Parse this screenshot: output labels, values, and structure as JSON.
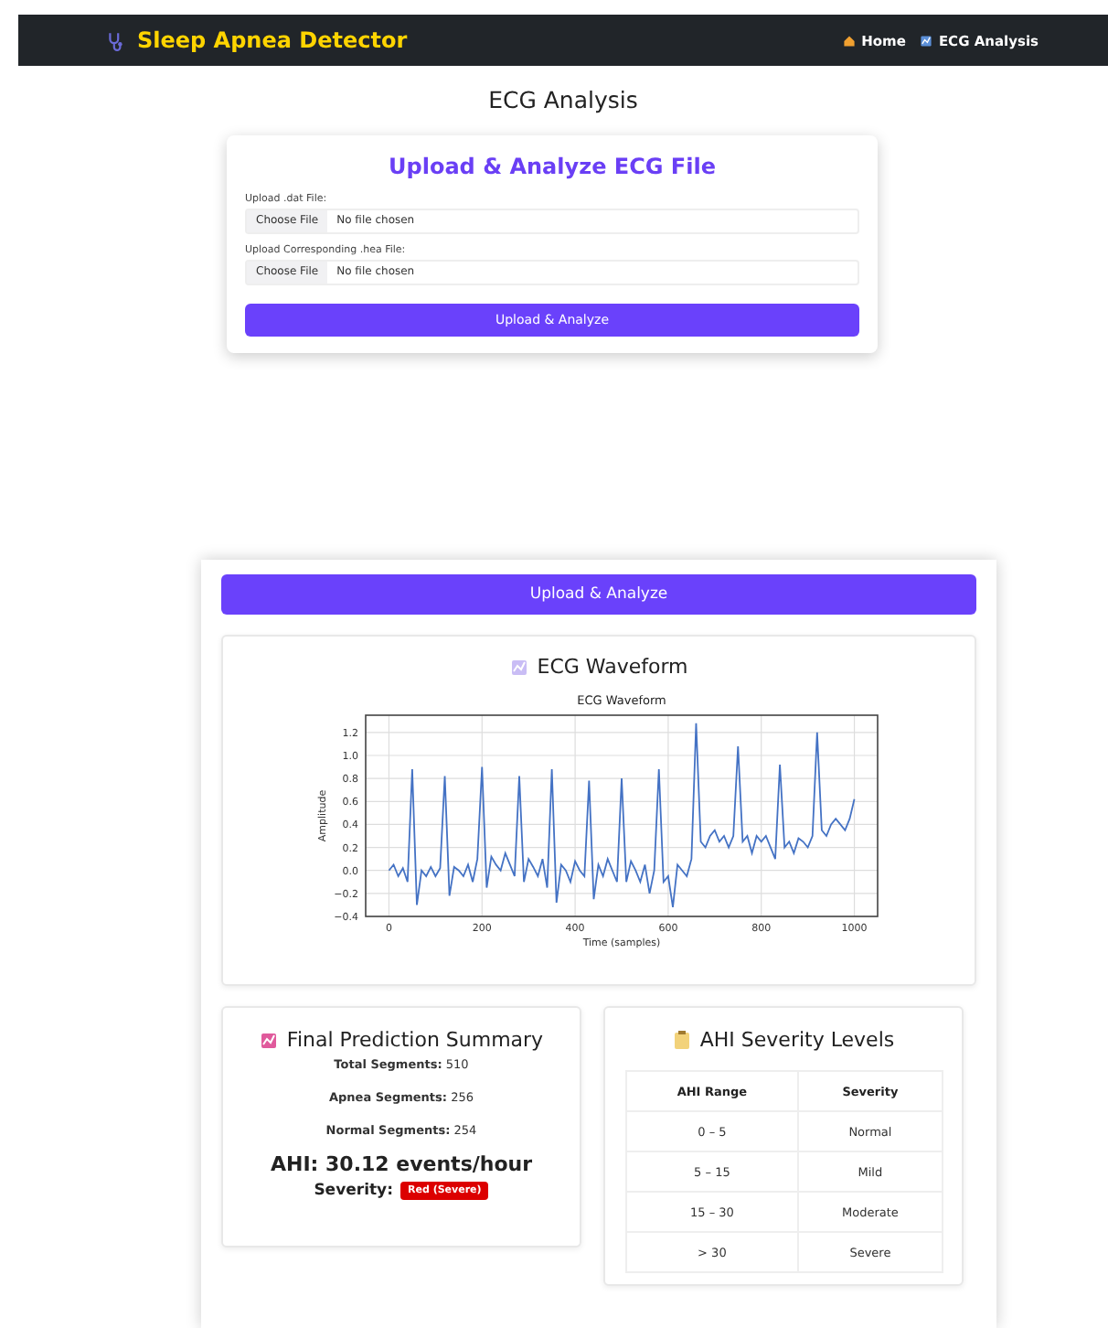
{
  "navbar": {
    "brand": "Sleep Apnea Detector",
    "links": [
      {
        "kind": "home",
        "label": "Home"
      },
      {
        "kind": "chart",
        "label": "ECG Analysis"
      }
    ]
  },
  "page_title": "ECG Analysis",
  "upload_card": {
    "title": "Upload & Analyze ECG File",
    "fields": [
      {
        "label": "Upload .dat File:",
        "button": "Choose File",
        "value": "No file chosen"
      },
      {
        "label": "Upload Corresponding .hea File:",
        "button": "Choose File",
        "value": "No file chosen"
      }
    ],
    "submit": "Upload & Analyze"
  },
  "results": {
    "submit": "Upload & Analyze",
    "waveform": {
      "title": "ECG Waveform",
      "chart_data": {
        "type": "line",
        "title": "ECG Waveform",
        "xlabel": "Time (samples)",
        "ylabel": "Amplitude",
        "xlim": [
          -50,
          1050
        ],
        "ylim": [
          -0.4,
          1.35
        ],
        "xticks": [
          0,
          200,
          400,
          600,
          800,
          1000
        ],
        "yticks": [
          {
            "value": -0.4,
            "label": "−0.4"
          },
          {
            "value": -0.2,
            "label": "−0.2"
          },
          {
            "value": 0,
            "label": "0.0"
          },
          {
            "value": 0.2,
            "label": "0.2"
          },
          {
            "value": 0.4,
            "label": "0.4"
          },
          {
            "value": 0.6,
            "label": "0.6"
          },
          {
            "value": 0.8,
            "label": "0.8"
          },
          {
            "value": 1.0,
            "label": "1.0"
          },
          {
            "value": 1.2,
            "label": "1.2"
          }
        ],
        "x": [
          0,
          10,
          20,
          30,
          40,
          50,
          60,
          70,
          80,
          90,
          100,
          110,
          120,
          130,
          140,
          150,
          160,
          170,
          180,
          190,
          200,
          210,
          220,
          230,
          240,
          250,
          260,
          270,
          280,
          290,
          300,
          310,
          320,
          330,
          340,
          350,
          360,
          370,
          380,
          390,
          400,
          410,
          420,
          430,
          440,
          450,
          460,
          470,
          480,
          490,
          500,
          510,
          520,
          530,
          540,
          550,
          560,
          570,
          580,
          590,
          600,
          610,
          620,
          630,
          640,
          650,
          660,
          670,
          680,
          690,
          700,
          710,
          720,
          730,
          740,
          750,
          760,
          770,
          780,
          790,
          800,
          810,
          820,
          830,
          840,
          850,
          860,
          870,
          880,
          890,
          900,
          910,
          920,
          930,
          940,
          950,
          960,
          970,
          980,
          990,
          1000
        ],
        "grid": true,
        "series": [
          {
            "color": "#4472c4",
            "values": [
              0.0,
              0.05,
              -0.05,
              0.02,
              -0.1,
              0.88,
              -0.3,
              0.0,
              -0.05,
              0.03,
              -0.05,
              0.02,
              0.82,
              -0.22,
              0.03,
              0.0,
              -0.05,
              0.05,
              -0.1,
              0.1,
              0.9,
              -0.15,
              0.12,
              0.05,
              0.0,
              0.15,
              0.05,
              -0.05,
              0.82,
              -0.1,
              0.1,
              0.03,
              -0.05,
              0.1,
              -0.15,
              0.88,
              -0.28,
              0.05,
              0.0,
              -0.1,
              0.08,
              0.0,
              -0.05,
              0.78,
              -0.25,
              0.05,
              -0.05,
              0.1,
              0.0,
              -0.1,
              0.8,
              -0.1,
              0.08,
              0.0,
              -0.1,
              0.05,
              -0.2,
              0.0,
              0.88,
              -0.1,
              -0.05,
              -0.32,
              0.05,
              0.0,
              -0.05,
              0.1,
              1.28,
              0.25,
              0.2,
              0.3,
              0.35,
              0.25,
              0.3,
              0.2,
              0.3,
              1.08,
              0.25,
              0.3,
              0.15,
              0.3,
              0.25,
              0.3,
              0.2,
              0.1,
              0.92,
              0.2,
              0.25,
              0.15,
              0.28,
              0.25,
              0.2,
              0.3,
              1.2,
              0.35,
              0.3,
              0.4,
              0.45,
              0.4,
              0.35,
              0.45,
              0.62
            ]
          }
        ]
      }
    },
    "summary": {
      "title": "Final Prediction Summary",
      "stats": [
        {
          "label": "Total Segments:",
          "value": "510"
        },
        {
          "label": "Apnea Segments:",
          "value": "256"
        },
        {
          "label": "Normal Segments:",
          "value": "254"
        }
      ],
      "ahi": "AHI: 30.12 events/hour",
      "severity_label": "Severity:",
      "severity": {
        "label": "Red (Severe)",
        "color": "#dc0000"
      }
    },
    "levels": {
      "title": "AHI Severity Levels",
      "columns": [
        "AHI Range",
        "Severity"
      ],
      "rows": [
        [
          "0 – 5",
          "Normal"
        ],
        [
          "5 – 15",
          "Mild"
        ],
        [
          "15 – 30",
          "Moderate"
        ],
        [
          "> 30",
          "Severe"
        ]
      ]
    }
  }
}
